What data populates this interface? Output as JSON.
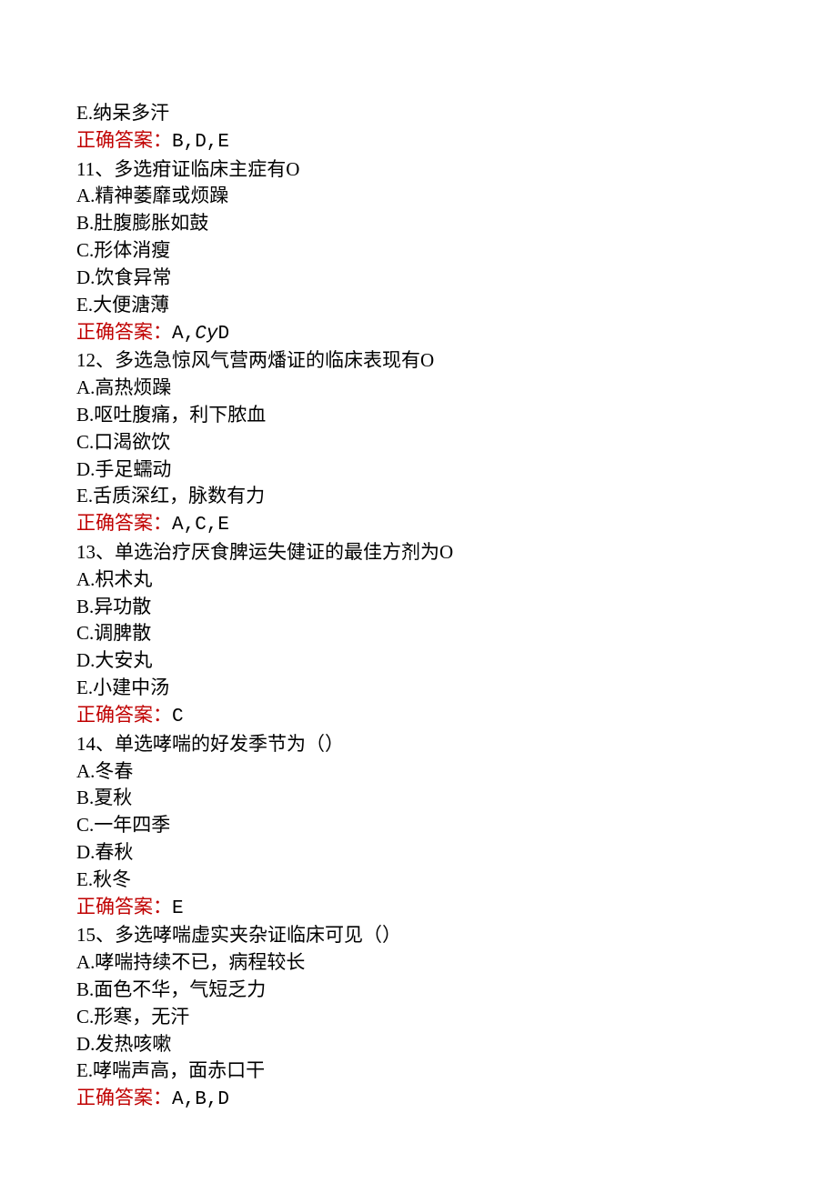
{
  "answer_label": "正确答案：",
  "q10": {
    "optE": "E.纳呆多汗",
    "ans": "B,D,E"
  },
  "q11": {
    "stem": "11、多选疳证临床主症有O",
    "optA": "A.精神萎靡或烦躁",
    "optB": "B.肚腹膨胀如鼓",
    "optC": "C.形体消瘦",
    "optD": "D.饮食异常",
    "optE": "E.大便溏薄",
    "ans_pre": "A,",
    "ans_ital": "Cy",
    "ans_post": "D"
  },
  "q12": {
    "stem": "12、多选急惊风气营两燔证的临床表现有O",
    "optA": "A.高热烦躁",
    "optB": "B.呕吐腹痛，利下脓血",
    "optC": "C.口渴欲饮",
    "optD": "D.手足蠕动",
    "optE": "E.舌质深红，脉数有力",
    "ans": "A,C,E"
  },
  "q13": {
    "stem": "13、单选治疗厌食脾运失健证的最佳方剂为O",
    "optA": "A.枳术丸",
    "optB": "B.异功散",
    "optC": "C.调脾散",
    "optD": "D.大安丸",
    "optE": "E.小建中汤",
    "ans": "C"
  },
  "q14": {
    "stem": "14、单选哮喘的好发季节为（）",
    "optA": "A.冬春",
    "optB": "B.夏秋",
    "optC": "C.一年四季",
    "optD": "D.春秋",
    "optE": "E.秋冬",
    "ans": "E"
  },
  "q15": {
    "stem": "15、多选哮喘虚实夹杂证临床可见（）",
    "optA": "A.哮喘持续不已，病程较长",
    "optB": "B.面色不华，气短乏力",
    "optC": "C.形寒，无汗",
    "optD": "D.发热咳嗽",
    "optE": "E.哮喘声高，面赤口干",
    "ans": "A,B,D"
  }
}
